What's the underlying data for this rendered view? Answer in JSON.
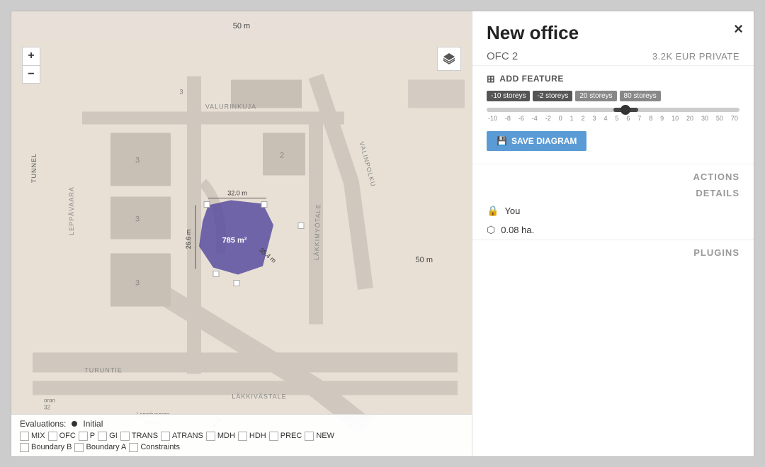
{
  "window": {
    "close_label": "×"
  },
  "sidebar": {
    "title": "New office",
    "meta_left": "OFC 2",
    "meta_right": "3.2K EUR PRIVATE",
    "add_feature_label": "ADD FEATURE",
    "storeys": {
      "tag1": "-10 storeys",
      "tag2": "-2 storeys",
      "tag3": "20 storeys",
      "tag4": "80 storeys"
    },
    "slider_axis": [
      "-10",
      "-8",
      "-6",
      "-4",
      "-2",
      "0",
      "1",
      "2",
      "3",
      "4",
      "5",
      "6",
      "7",
      "8",
      "9",
      "10",
      "20",
      "30",
      "50",
      "70"
    ],
    "save_diagram_label": "SAVE DIAGRAM",
    "actions_label": "ACTIONS",
    "details_label": "DETAILS",
    "plugins_label": "PLUGINS",
    "user_label": "You",
    "area_label": "0.08 ha."
  },
  "map": {
    "scale_top": "50 m",
    "scale_right": "50 m",
    "zoom_plus": "+",
    "zoom_minus": "−",
    "tunnel_label": "TUNNEL",
    "area_label": "785 m²",
    "dim1": "32.0 m",
    "dim2": "26.6 m",
    "dim3": "35.4 m"
  },
  "evaluations": {
    "label": "Evaluations:",
    "dot": "●",
    "initial": "Initial",
    "checkboxes": [
      "MIX",
      "OFC",
      "P",
      "GI",
      "TRANS",
      "ATRANS",
      "MDH",
      "HDH",
      "PREC",
      "NEW"
    ],
    "checkboxes2": [
      "Boundary B",
      "Boundary A",
      "Constraints"
    ]
  }
}
